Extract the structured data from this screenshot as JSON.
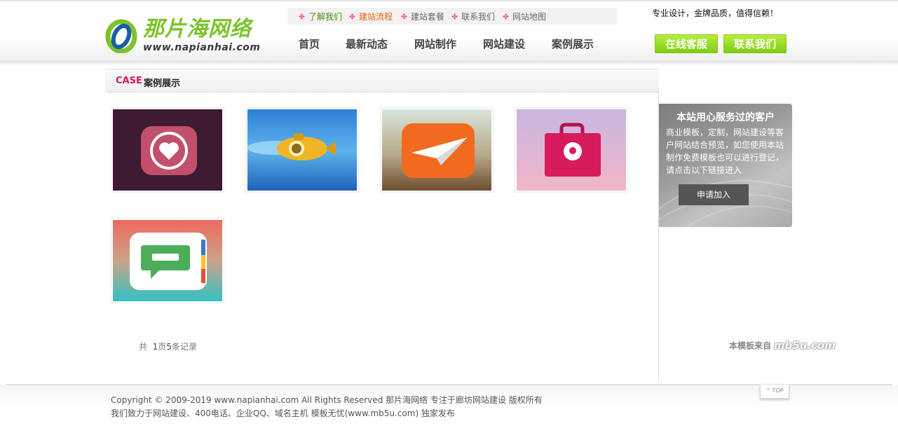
{
  "brand": {
    "name_cn": "那片海网络",
    "url_text": "www.napianhai.com"
  },
  "topbar": {
    "links": [
      {
        "label": "了解我们",
        "color": "#4d8c15"
      },
      {
        "label": "建站流程",
        "color": "#e06a0a"
      },
      {
        "label": "建站套餐",
        "color": "#666666"
      },
      {
        "label": "联系我们",
        "color": "#666666"
      },
      {
        "label": "网站地图",
        "color": "#666666"
      }
    ]
  },
  "slogan": "专业设计，金牌品质，值得信赖！",
  "nav": {
    "items": [
      "首页",
      "最新动态",
      "网站制作",
      "网站建设",
      "案例展示"
    ]
  },
  "header_buttons": {
    "online_service": "在线客服",
    "contact_us": "联系我们"
  },
  "section": {
    "title_en": "CASE",
    "title_cn": "案例展示"
  },
  "cases": [
    {
      "icon": "heart-badge-icon"
    },
    {
      "icon": "submarine-icon"
    },
    {
      "icon": "paper-plane-icon"
    },
    {
      "icon": "shopping-bag-pin-icon"
    },
    {
      "icon": "chat-bubble-icon"
    }
  ],
  "pager": {
    "prefix": "共",
    "pages": "1",
    "page_unit": "页",
    "records": "5",
    "record_unit": "条记录"
  },
  "side_panel": {
    "title": "本站用心服务过的客户",
    "text": "商业模板，定制，网站建设等客户网站结合预览，如您使用本站制作免费模板也可以进行登记，请点击以下链接进入",
    "button": "申请加入"
  },
  "template_source": {
    "prefix": "本模板来自",
    "name": "mb5u.com"
  },
  "footer": {
    "line1": "Copyright © 2009-2019 www.napianhai.com All Rights Reserved 那片海网络 专注于廊坊网站建设 版权所有",
    "line2": "我们致力于网站建设、400电话、企业QQ、域名主机 模板无忧(www.mb5u.com) 独家发布",
    "top_button": "^ TOP"
  },
  "colors": {
    "brand_green": "#7cc32a",
    "case_red": "#d21b4e",
    "button_green": "#8bc81e"
  }
}
